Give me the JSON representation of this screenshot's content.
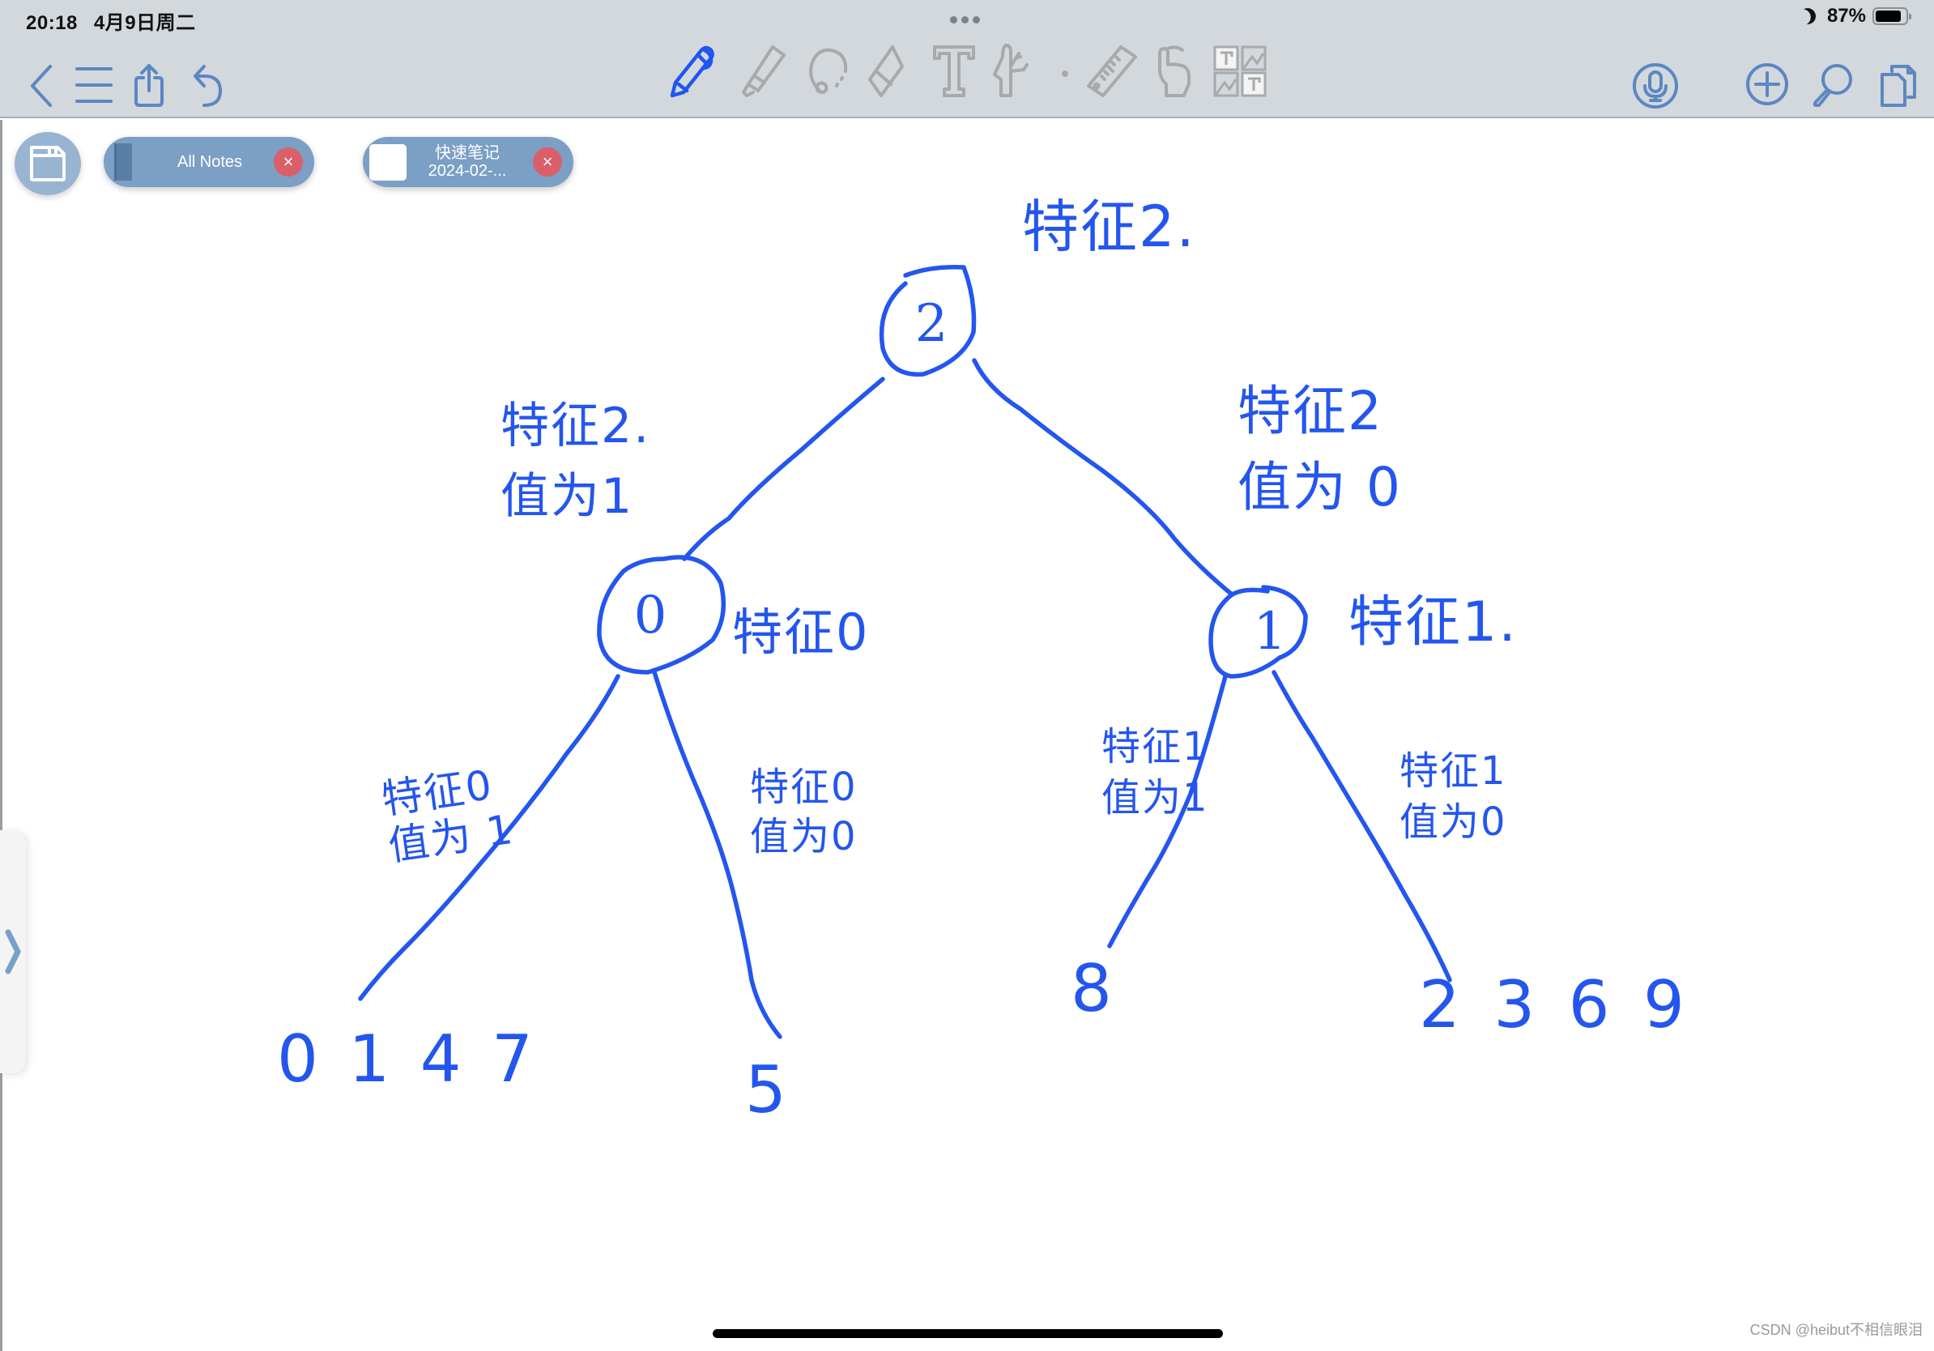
{
  "status_bar": {
    "time": "20:18",
    "date": "4月9日周二",
    "battery_percent": "87%",
    "battery_level": 0.87,
    "focus_mode_icon": "moon-icon"
  },
  "toolbar": {
    "left_icons": [
      "back-chevron-icon",
      "menu-list-icon",
      "share-icon",
      "undo-icon"
    ],
    "tools": [
      {
        "name": "pen",
        "icon": "pen-icon",
        "active": true
      },
      {
        "name": "highlighter",
        "icon": "highlighter-icon",
        "active": false
      },
      {
        "name": "lasso",
        "icon": "lasso-icon",
        "active": false
      },
      {
        "name": "eraser",
        "icon": "eraser-icon",
        "active": false
      },
      {
        "name": "text",
        "icon": "text-tool-icon",
        "active": false
      },
      {
        "name": "elements",
        "icon": "multitool-icon",
        "active": false
      },
      {
        "name": "ruler",
        "icon": "ruler-icon",
        "active": false
      },
      {
        "name": "pointer",
        "icon": "hand-pointer-icon",
        "active": false
      },
      {
        "name": "image-text",
        "icon": "image-text-icon",
        "active": false
      }
    ],
    "right_icons": [
      "microphone-icon",
      "add-page-icon",
      "search-icon",
      "pages-icon"
    ],
    "active_color": "#1f55f0"
  },
  "tabs": [
    {
      "label": "All Notes",
      "close": "×"
    },
    {
      "label_line1": "快速笔记",
      "label_line2": "2024-02-...",
      "close": "×"
    }
  ],
  "side_handle": {
    "icon": "chevron-right-icon",
    "glyph": "❯"
  },
  "diagram": {
    "ink_color": "#2456ee",
    "nodes": [
      {
        "id": "root",
        "label": "2",
        "annotation": "特征2."
      },
      {
        "id": "left",
        "label": "0",
        "annotation": "特征0"
      },
      {
        "id": "right",
        "label": "1",
        "annotation": "特征1."
      }
    ],
    "edges": [
      {
        "from": "root",
        "to": "left",
        "label_line1": "特征2.",
        "label_line2": "值为1"
      },
      {
        "from": "root",
        "to": "right",
        "label_line1": "特征2",
        "label_line2": "值为 0"
      },
      {
        "from": "left",
        "to": "leaf-0147",
        "label_line1": "特征0",
        "label_line2": "值为 1"
      },
      {
        "from": "left",
        "to": "leaf-5",
        "label_line1": "特征0",
        "label_line2": "值为0"
      },
      {
        "from": "right",
        "to": "leaf-8",
        "label_line1": "特征1",
        "label_line2": "值为1"
      },
      {
        "from": "right",
        "to": "leaf-2369",
        "label_line1": "特征1",
        "label_line2": "值为0"
      }
    ],
    "leaves": [
      {
        "id": "leaf-0147",
        "text": "0 1 4 7"
      },
      {
        "id": "leaf-5",
        "text": "5"
      },
      {
        "id": "leaf-8",
        "text": "8"
      },
      {
        "id": "leaf-2369",
        "text": "2 3 6 9"
      }
    ]
  },
  "watermark": "CSDN @heibut不相信眼泪"
}
